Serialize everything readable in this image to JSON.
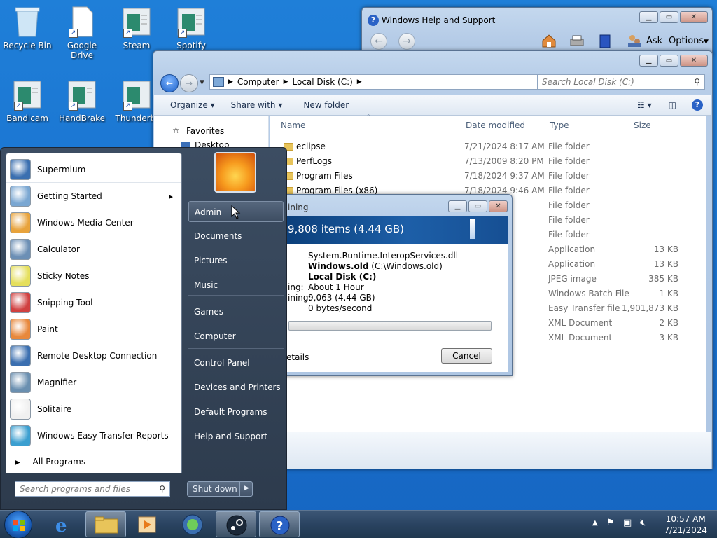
{
  "desktop_icons": [
    {
      "label": "Recycle Bin",
      "icon": "recycle-bin-icon"
    },
    {
      "label": "Google Drive",
      "icon": "google-drive-icon"
    },
    {
      "label": "Steam",
      "icon": "steam-icon"
    },
    {
      "label": "Spotify",
      "icon": "spotify-icon"
    },
    {
      "label": "Bandicam",
      "icon": "bandicam-icon"
    },
    {
      "label": "HandBrake",
      "icon": "handbrake-icon"
    },
    {
      "label": "Thunderbi",
      "icon": "thunderbird-icon"
    }
  ],
  "help_window": {
    "title": "Windows Help and Support",
    "ask": "Ask",
    "options": "Options"
  },
  "explorer": {
    "breadcrumb": [
      "Computer",
      "Local Disk (C:)"
    ],
    "search_placeholder": "Search Local Disk (C:)",
    "toolbar": {
      "organize": "Organize",
      "share": "Share with",
      "new_folder": "New folder"
    },
    "nav": {
      "favorites": "Favorites",
      "desktop": "Desktop"
    },
    "columns": {
      "name": "Name",
      "date": "Date modified",
      "type": "Type",
      "size": "Size"
    },
    "rows": [
      {
        "name": "eclipse",
        "date": "7/21/2024 8:17 AM",
        "type": "File folder",
        "size": ""
      },
      {
        "name": "PerfLogs",
        "date": "7/13/2009 8:20 PM",
        "type": "File folder",
        "size": ""
      },
      {
        "name": "Program Files",
        "date": "7/18/2024 9:37 AM",
        "type": "File folder",
        "size": ""
      },
      {
        "name": "Program Files (x86)",
        "date": "7/18/2024 9:46 AM",
        "type": "File folder",
        "size": ""
      },
      {
        "name": "",
        "date": "49 PM",
        "type": "File folder",
        "size": ""
      },
      {
        "name": "",
        "date": "49 PM",
        "type": "File folder",
        "size": ""
      },
      {
        "name": "",
        "date": "33 AM",
        "type": "File folder",
        "size": ""
      },
      {
        "name": "",
        "date": "08 AM",
        "type": "Application",
        "size": "13 KB"
      },
      {
        "name": "",
        "date": ":49 ...",
        "type": "Application",
        "size": "13 KB"
      },
      {
        "name": "",
        "date": "9 AM",
        "type": "JPEG image",
        "size": "385 KB"
      },
      {
        "name": "",
        "date": "8 PM",
        "type": "Windows Batch File",
        "size": "1 KB"
      },
      {
        "name": "",
        "date": "30 AM",
        "type": "Easy Transfer file",
        "size": "1,901,873 KB"
      },
      {
        "name": "",
        "date": "0 PM",
        "type": "XML Document",
        "size": "2 KB"
      },
      {
        "name": "",
        "date": "4 PM",
        "type": "XML Document",
        "size": "3 KB"
      }
    ]
  },
  "copy_dialog": {
    "title": "ining",
    "banner": "9,808 items (4.44 GB)",
    "file": "System.Runtime.InteropServices.dll",
    "from_bold": "Windows.old",
    "from_rest": "(C:\\Windows.old)",
    "to": "Local Disk (C:)",
    "time_label": "ing:",
    "time_value": "About 1 Hour",
    "items_label": "ining:",
    "items_value": "9,063 (4.44 GB)",
    "speed": "0 bytes/second",
    "details": "etails",
    "cancel": "Cancel",
    "progress": 0.0
  },
  "start_menu": {
    "programs": [
      {
        "label": "Supermium",
        "icon": "supermium-icon"
      },
      {
        "label": "Getting Started",
        "icon": "getting-started-icon",
        "arrow": "▸"
      },
      {
        "label": "Windows Media Center",
        "icon": "media-center-icon"
      },
      {
        "label": "Calculator",
        "icon": "calculator-icon"
      },
      {
        "label": "Sticky Notes",
        "icon": "sticky-notes-icon"
      },
      {
        "label": "Snipping Tool",
        "icon": "snipping-tool-icon"
      },
      {
        "label": "Paint",
        "icon": "paint-icon"
      },
      {
        "label": "Remote Desktop Connection",
        "icon": "remote-desktop-icon"
      },
      {
        "label": "Magnifier",
        "icon": "magnifier-icon"
      },
      {
        "label": "Solitaire",
        "icon": "solitaire-icon"
      },
      {
        "label": "Windows Easy Transfer Reports",
        "icon": "easy-transfer-icon"
      }
    ],
    "all_programs": "All Programs",
    "search_placeholder": "Search programs and files",
    "right_links": [
      "Admin",
      "Documents",
      "Pictures",
      "Music",
      "Games",
      "Computer",
      "Control Panel",
      "Devices and Printers",
      "Default Programs",
      "Help and Support"
    ],
    "shutdown": "Shut down"
  },
  "taskbar": {
    "time": "10:57 AM",
    "date": "7/21/2024"
  },
  "colors": {
    "desktop": "#1a73d0",
    "selection": "#cce4f7"
  }
}
